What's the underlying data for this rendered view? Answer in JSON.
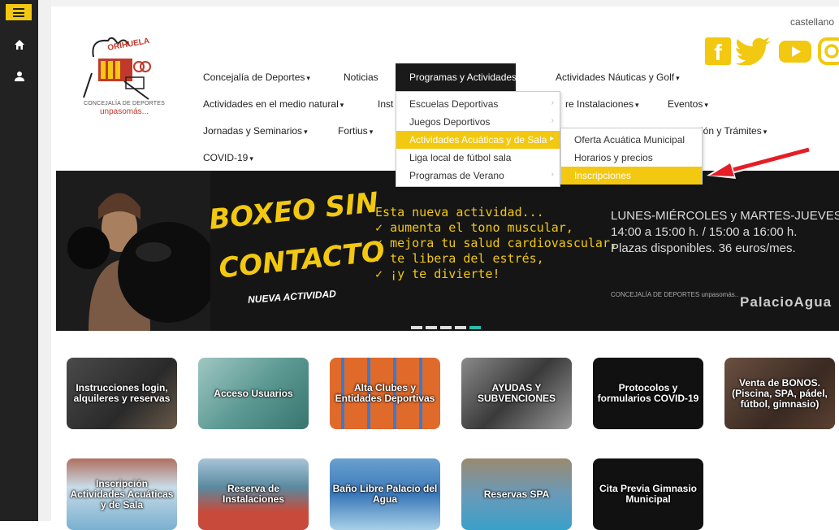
{
  "sidebar": {
    "items": [
      "menu-icon",
      "home-icon",
      "user-icon"
    ]
  },
  "header": {
    "language": "castellano",
    "logo": {
      "name": "ORIHUELA",
      "line1": "CONCEJALÍA DE DEPORTES",
      "line2": "unpasomás..."
    },
    "social": [
      "facebook-icon",
      "twitter-icon",
      "youtube-icon",
      "instagram-icon"
    ]
  },
  "nav": {
    "row1": [
      "Concejalía de Deportes",
      "Noticias",
      "Programas y Actividades",
      "Actividades Náuticas y Golf"
    ],
    "row2": [
      "Actividades en el medio natural",
      "Inst",
      "re Instalaciones",
      "Eventos"
    ],
    "row3": [
      "Jornadas y Seminarios",
      "Fortius",
      "ión y Trámites"
    ],
    "row4": [
      "COVID-19"
    ]
  },
  "dropdown": {
    "items": [
      "Escuelas Deportivas",
      "Juegos Deportivos",
      "Actividades Acuáticas y de Sala",
      "Liga local de fútbol sala",
      "Programas de Verano"
    ],
    "submenu": [
      "Oferta Acuática Municipal",
      "Horarios y precios",
      "Inscripciones"
    ]
  },
  "banner": {
    "title_line1": "BOXEO SIN",
    "title_line2": "CONTACTO",
    "subtitle": "NUEVA ACTIVIDAD",
    "intro": "Esta nueva actividad...",
    "bullets": [
      "aumenta el tono muscular,",
      "mejora tu salud cardiovascular,",
      "te libera del estrés,",
      "¡y te divierte!"
    ],
    "schedule": [
      "LUNES-MIÉRCOLES y MARTES-JUEVES",
      "14:00 a 15:00 h. / 15:00 a 16:00 h.",
      "Plazas disponibles. 36 euros/mes."
    ],
    "footer_logo": "CONCEJALÍA DE DEPORTES unpasomás..",
    "footer_brand": "PalacioAgua",
    "slide_count": 5,
    "active_slide": 5
  },
  "tiles": [
    "Instrucciones login, alquileres y reservas",
    "Acceso Usuarios",
    "Alta Clubes y Entidades Deportivas",
    "AYUDAS Y SUBVENCIONES",
    "Protocolos y formularios COVID-19",
    "Venta de BONOS. (Piscina, SPA, pádel, fútbol, gimnasio)",
    "Inscripción Actividades Acuáticas y de Sala",
    "Reserva de Instalaciones",
    "Baño Libre Palacio del Agua",
    "Reservas SPA",
    "Cita Previa Gimnasio Municipal"
  ],
  "colors": {
    "accent": "#f2c811",
    "sidebar": "#222222",
    "active_nav": "#1a1a1a",
    "arrow": "#e41e26"
  }
}
